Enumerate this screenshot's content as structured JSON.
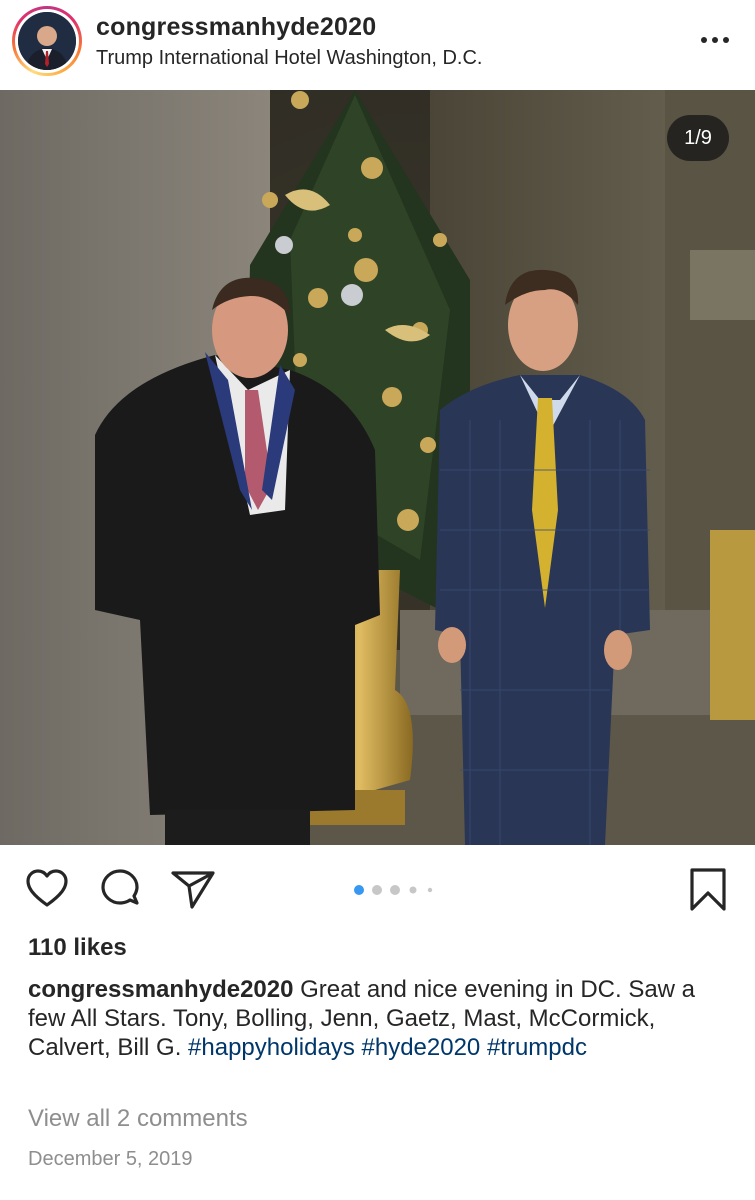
{
  "post": {
    "username": "congressmanhyde2020",
    "location": "Trump International Hotel Washington, D.C.",
    "more_icon": "more-horizontal-icon",
    "counter": "1/9",
    "carousel": {
      "total": 5,
      "active": 1
    },
    "likes": "110 likes",
    "caption": {
      "username": "congressmanhyde2020",
      "text": " Great and nice evening in DC. Saw a few All Stars. Tony, Bolling, Jenn, Gaetz, Mast, McCormick, Calvert, Bill G. ",
      "hashtags": [
        "#happyholidays",
        "#hyde2020",
        "#trumpdc"
      ]
    },
    "view_comments": "View all 2 comments",
    "date": "December 5, 2019"
  },
  "icons": {
    "like": "heart-icon",
    "comment": "comment-icon",
    "share": "share-icon",
    "save": "bookmark-icon"
  },
  "colors": {
    "text": "#262626",
    "secondary": "#8e8e8e",
    "hashtag": "#00376b",
    "active_dot": "#3897f0",
    "inactive_dot": "#c7c7c7"
  }
}
